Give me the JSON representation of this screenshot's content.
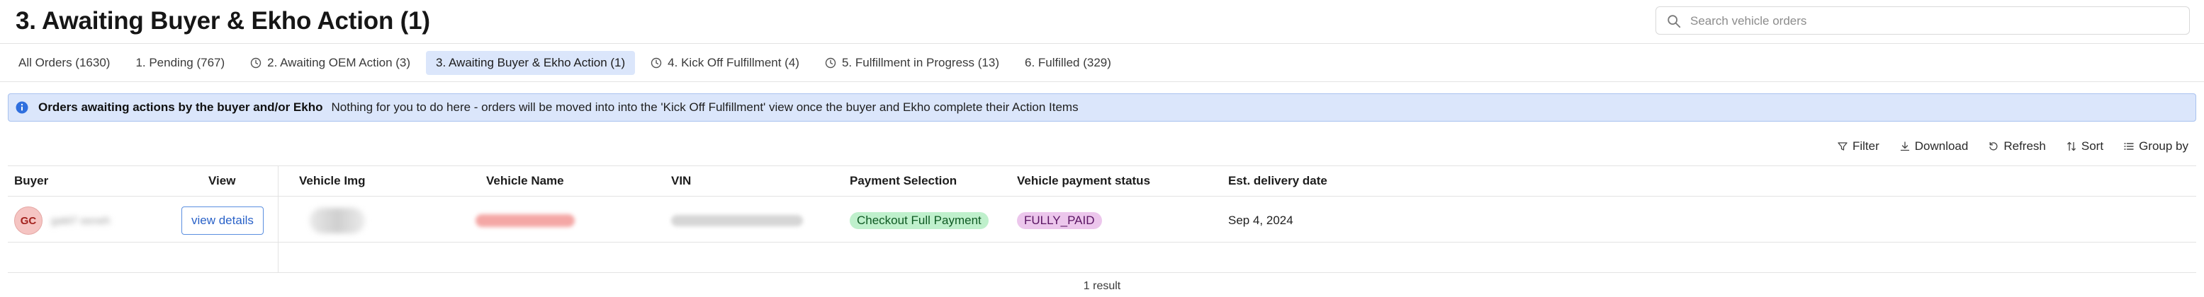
{
  "header": {
    "title": "3. Awaiting Buyer & Ekho Action (1)",
    "search_placeholder": "Search vehicle orders"
  },
  "tabs": [
    {
      "label": "All Orders (1630)",
      "icon": "",
      "active": false
    },
    {
      "label": "1. Pending (767)",
      "icon": "",
      "active": false
    },
    {
      "label": "2. Awaiting OEM Action (3)",
      "icon": "clock-icon",
      "active": false
    },
    {
      "label": "3. Awaiting Buyer & Ekho Action (1)",
      "icon": "",
      "active": true
    },
    {
      "label": "4. Kick Off Fulfillment (4)",
      "icon": "clock-icon",
      "active": false
    },
    {
      "label": "5. Fulfillment in Progress (13)",
      "icon": "clock-icon",
      "active": false
    },
    {
      "label": "6. Fulfilled (329)",
      "icon": "",
      "active": false
    }
  ],
  "banner": {
    "title": "Orders awaiting actions by the buyer and/or Ekho",
    "message": "Nothing for you to do here - orders will be moved into into the 'Kick Off Fulfillment' view once the buyer and Ekho complete their Action Items",
    "icon": "info-icon"
  },
  "toolbar": {
    "filter": "Filter",
    "download": "Download",
    "refresh": "Refresh",
    "sort": "Sort",
    "group_by": "Group by"
  },
  "table": {
    "columns": {
      "buyer": "Buyer",
      "view": "View",
      "vehicle_img": "Vehicle Img",
      "vehicle_name": "Vehicle Name",
      "vin": "VIN",
      "payment_selection": "Payment Selection",
      "vehicle_payment_status": "Vehicle payment status",
      "est_delivery_date": "Est. delivery date"
    },
    "rows": [
      {
        "buyer_initials": "GC",
        "buyer_name": "gaM7 eeneh",
        "view_label": "view details",
        "payment_selection": "Checkout Full Payment",
        "vehicle_payment_status": "FULLY_PAID",
        "est_delivery_date": "Sep 4, 2024"
      }
    ]
  },
  "footer": {
    "result_count": "1 result"
  },
  "colors": {
    "accent": "#2a62c8",
    "active_tab_bg": "#dbe6fb",
    "banner_bg": "#dbe6fb",
    "tag_green_bg": "#bff0cc",
    "tag_purple_bg": "#ecc6ec",
    "avatar_bg": "#f5c4c2"
  }
}
